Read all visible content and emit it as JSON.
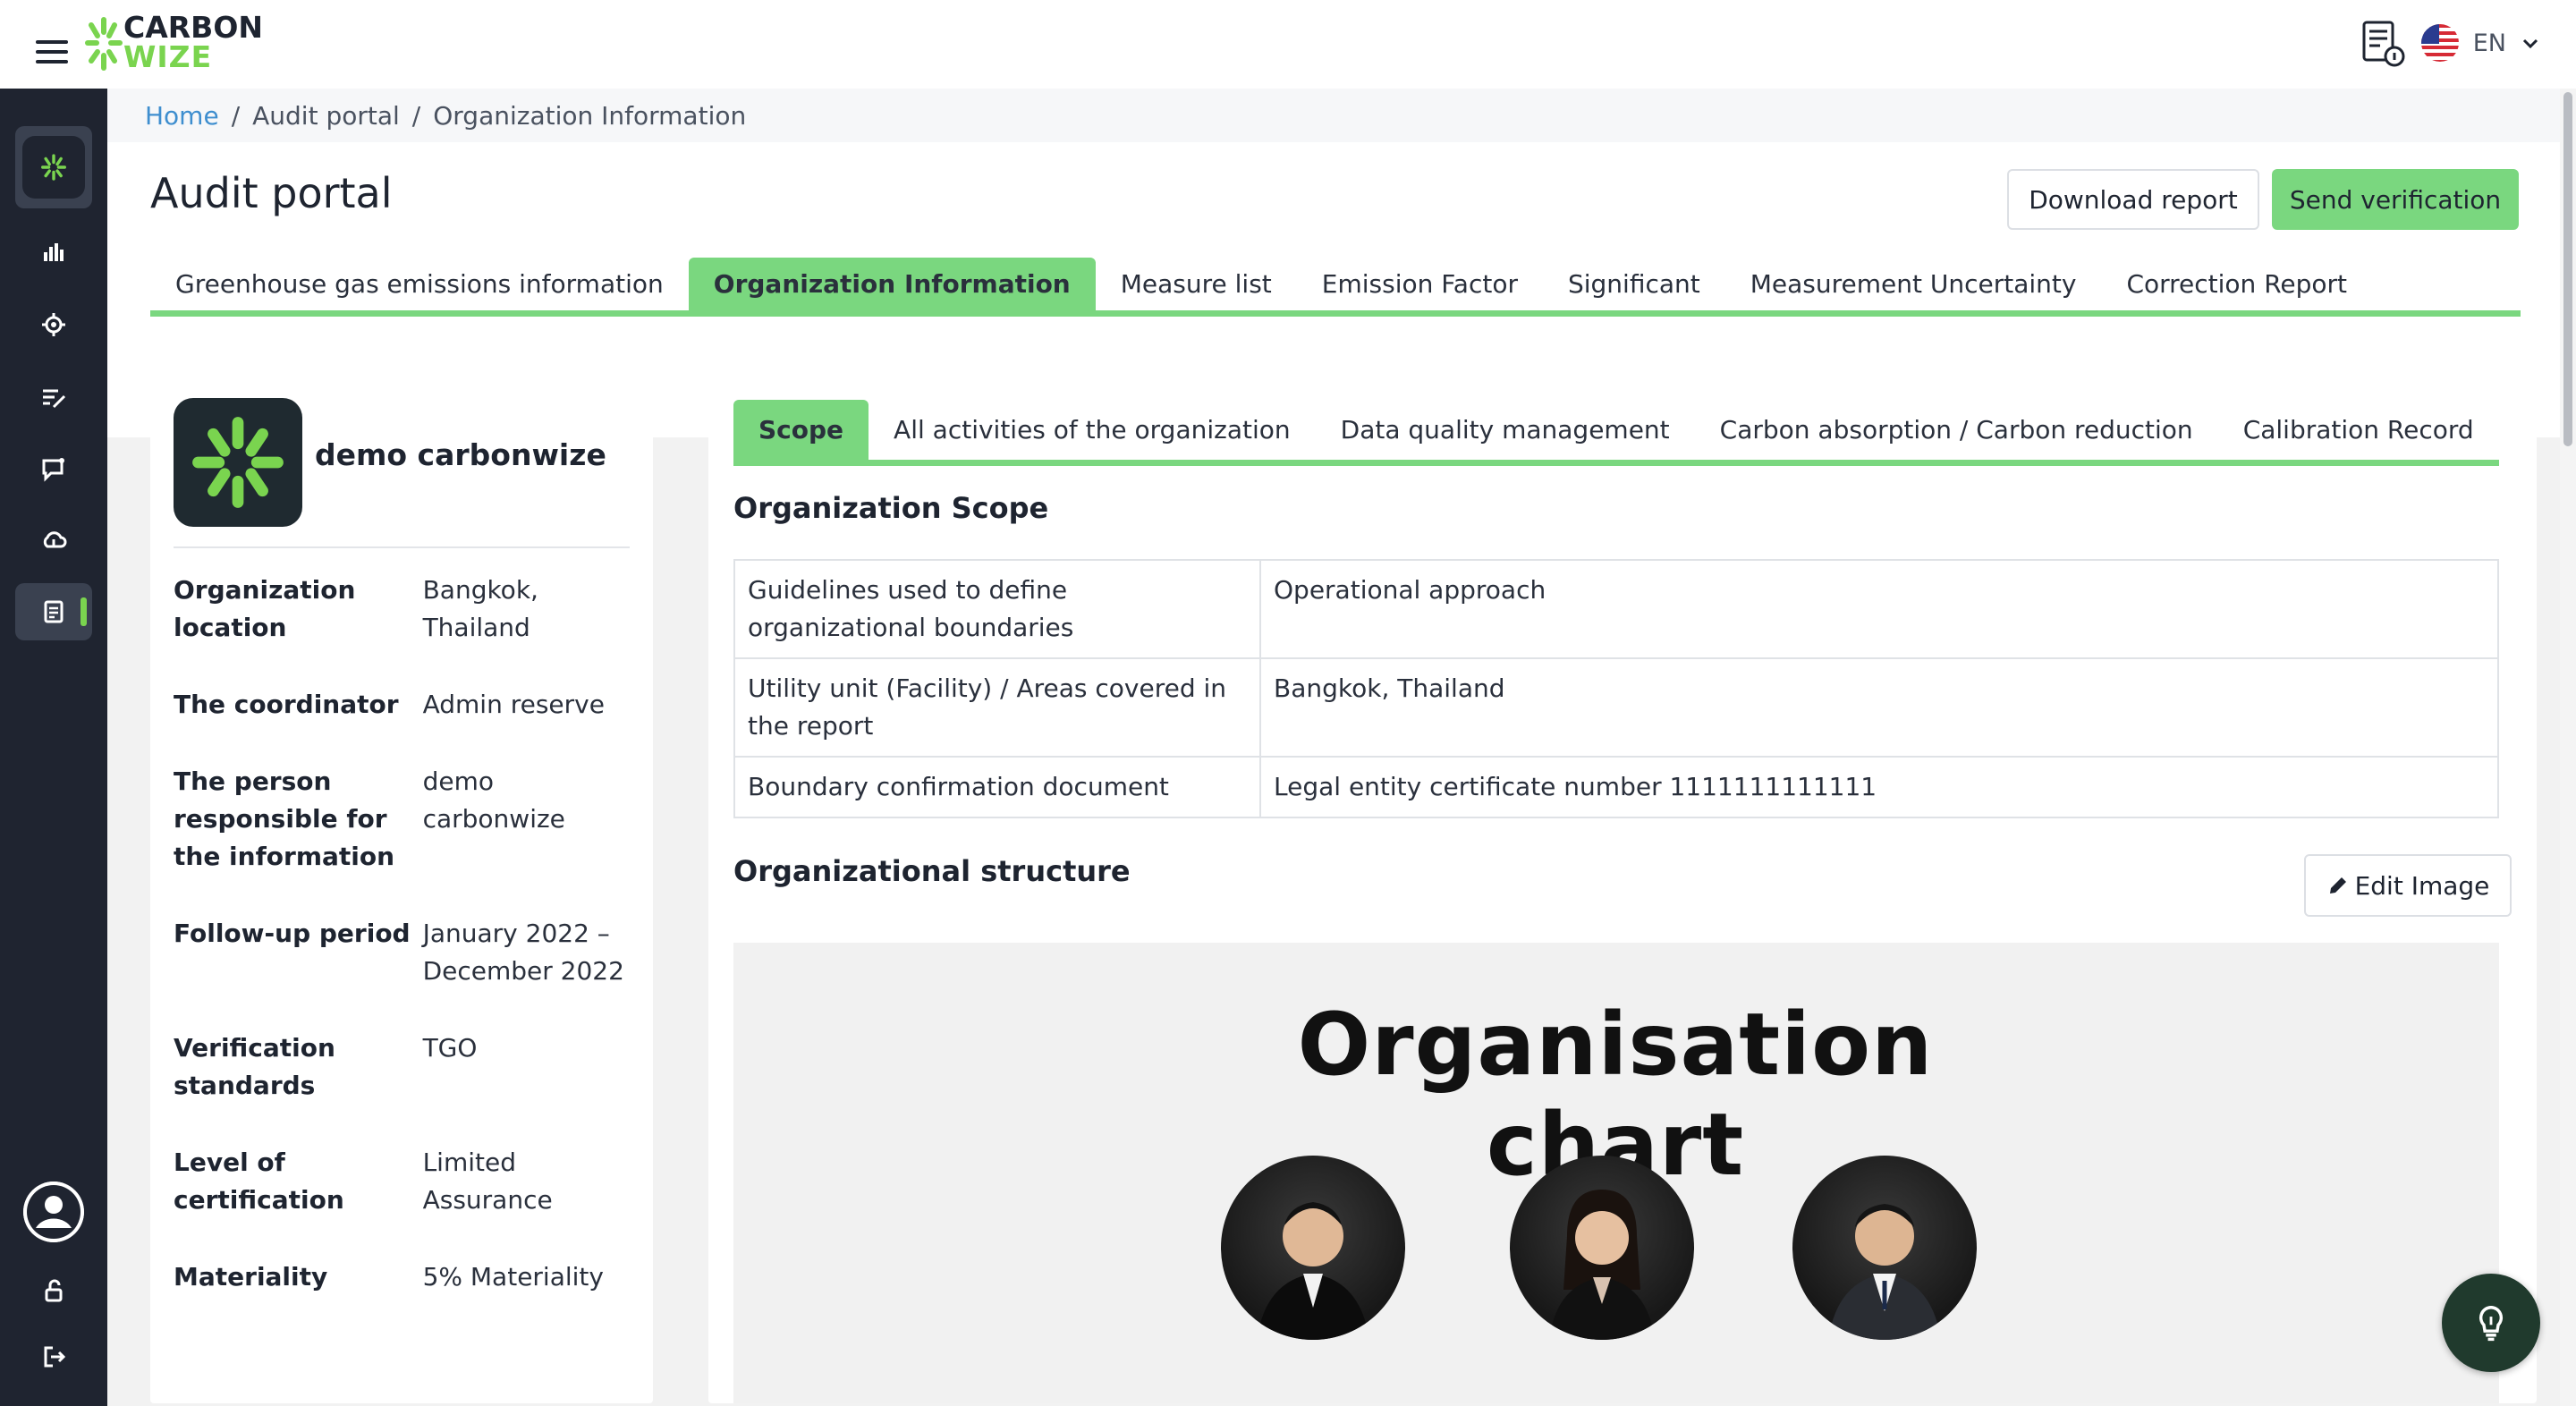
{
  "app": {
    "logo_line1": "CARBON",
    "logo_line2": "WIZE",
    "language": "EN"
  },
  "icons": {
    "menu": "hamburger-icon",
    "report": "report-icon",
    "flag": "us-flag-icon",
    "lang_caret": "chevron-down-icon",
    "edit": "pencil-icon",
    "help": "lightbulb-icon"
  },
  "sidebar": {
    "items": [
      {
        "name": "brand",
        "icon": "carbonwize-mark-icon"
      },
      {
        "name": "dashboard",
        "icon": "bar-chart-icon"
      },
      {
        "name": "settings",
        "icon": "gear-icon"
      },
      {
        "name": "edit-list",
        "icon": "edit-list-icon"
      },
      {
        "name": "feedback",
        "icon": "message-icon"
      },
      {
        "name": "cloud",
        "icon": "cloud-icon"
      },
      {
        "name": "audit",
        "icon": "document-icon",
        "active": true
      }
    ],
    "bottom": [
      "user-avatar-icon",
      "unlock-icon",
      "logout-icon"
    ]
  },
  "breadcrumb": {
    "home": "Home",
    "sep": "/",
    "section": "Audit portal",
    "current": "Organization Information"
  },
  "page": {
    "title": "Audit portal",
    "download_label": "Download report",
    "send_label": "Send verification"
  },
  "tabs": [
    "Greenhouse gas emissions information",
    "Organization Information",
    "Measure list",
    "Emission Factor",
    "Significant",
    "Measurement Uncertainty",
    "Correction Report"
  ],
  "active_tab": "Organization Information",
  "organization": {
    "name": "demo carbonwize",
    "fields": [
      {
        "label": "Organization location",
        "value": "Bangkok, Thailand"
      },
      {
        "label": "The coordinator",
        "value": "Admin reserve"
      },
      {
        "label": "The person responsible for the information",
        "value": "demo carbonwize"
      },
      {
        "label": "Follow-up period",
        "value": "January 2022 – December 2022"
      },
      {
        "label": "Verification standards",
        "value": "TGO"
      },
      {
        "label": "Level of certification",
        "value": "Limited Assurance"
      },
      {
        "label": "Materiality",
        "value": "5% Materiality"
      }
    ]
  },
  "subtabs": [
    "Scope",
    "All activities of the organization",
    "Data quality management",
    "Carbon absorption / Carbon reduction",
    "Calibration Record"
  ],
  "active_subtab": "Scope",
  "scope": {
    "title": "Organization Scope",
    "rows": [
      {
        "key": "Guidelines used to define organizational boundaries",
        "value": "Operational approach"
      },
      {
        "key": "Utility unit (Facility) / Areas covered in the report",
        "value": "Bangkok, Thailand"
      },
      {
        "key": "Boundary confirmation document",
        "value": "Legal entity certificate number 1111111111111"
      }
    ]
  },
  "structure": {
    "title": "Organizational structure",
    "edit_label": "Edit Image",
    "chart_heading": "Organisation chart"
  },
  "colors": {
    "accent": "#7ad77f",
    "brand_green": "#7ad44f",
    "sidebar": "#1f2430",
    "link": "#3e8ecf"
  }
}
